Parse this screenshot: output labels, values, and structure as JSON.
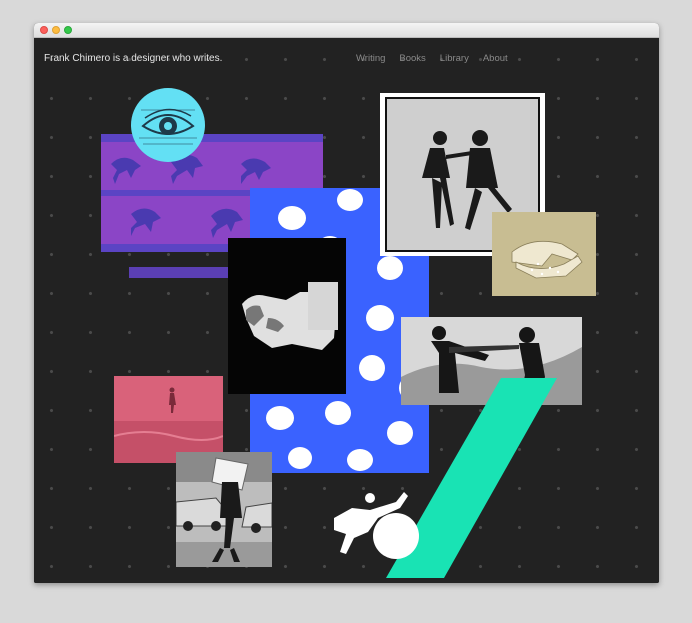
{
  "site": {
    "title": "Frank Chimero is a designer who writes."
  },
  "nav": {
    "items": [
      {
        "label": "Writing"
      },
      {
        "label": "Books"
      },
      {
        "label": "Library"
      },
      {
        "label": "About"
      }
    ]
  },
  "colors": {
    "background": "#222222",
    "dots": "#4a4a4a",
    "cyan": "#63e0f4",
    "purple": "#8b45c6",
    "blue": "#3a62ff",
    "mint": "#19e3b4",
    "pink": "#d9627a",
    "violet": "#5b3fb4"
  },
  "collage": {
    "items": [
      {
        "name": "eye-engraving",
        "subject": "eye"
      },
      {
        "name": "horse-motion-strip",
        "subject": "galloping horses"
      },
      {
        "name": "dancing-couple-photo",
        "subject": "dancing couple"
      },
      {
        "name": "hands-photo",
        "subject": "hands"
      },
      {
        "name": "blue-dot-pattern",
        "subject": "white dots on blue"
      },
      {
        "name": "sculpture-head-photo",
        "subject": "classical head"
      },
      {
        "name": "two-people-outdoors-photo",
        "subject": "two people"
      },
      {
        "name": "pink-beach-photo",
        "subject": "figure on beach"
      },
      {
        "name": "street-photo",
        "subject": "man carrying box"
      },
      {
        "name": "mint-slash",
        "subject": "green diagonal bar"
      },
      {
        "name": "white-figure-silhouette",
        "subject": "leaping figure with ball"
      }
    ]
  }
}
